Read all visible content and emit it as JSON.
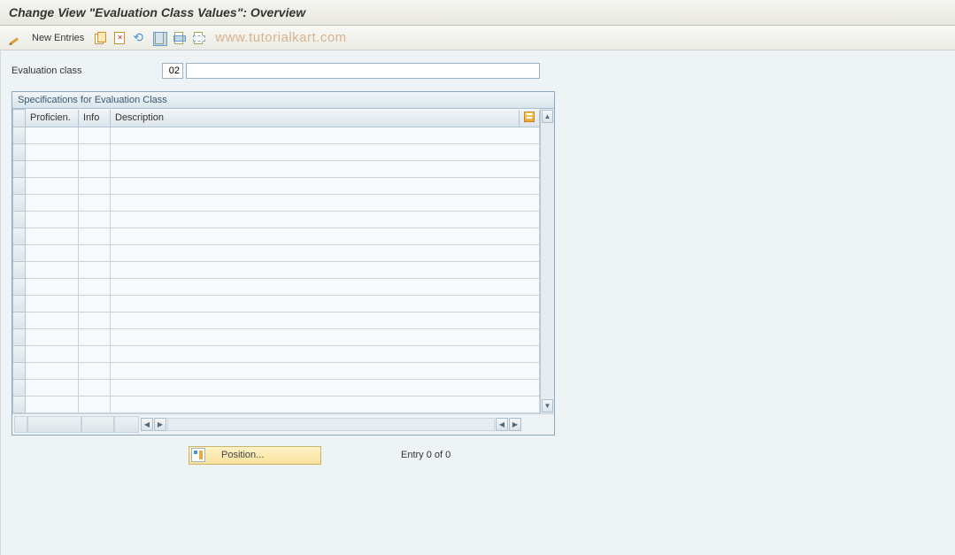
{
  "title": "Change View \"Evaluation Class Values\": Overview",
  "toolbar": {
    "new_entries_label": "New Entries"
  },
  "watermark": "www.tutorialkart.com",
  "form": {
    "evaluation_class_label": "Evaluation class",
    "evaluation_class_value": "02",
    "evaluation_class_desc": ""
  },
  "panel": {
    "title": "Specifications for Evaluation Class",
    "columns": {
      "proficiency": "Proficien.",
      "info": "Info",
      "description": "Description"
    },
    "row_count": 17
  },
  "footer": {
    "position_label": "Position...",
    "entry_text": "Entry 0 of 0"
  }
}
